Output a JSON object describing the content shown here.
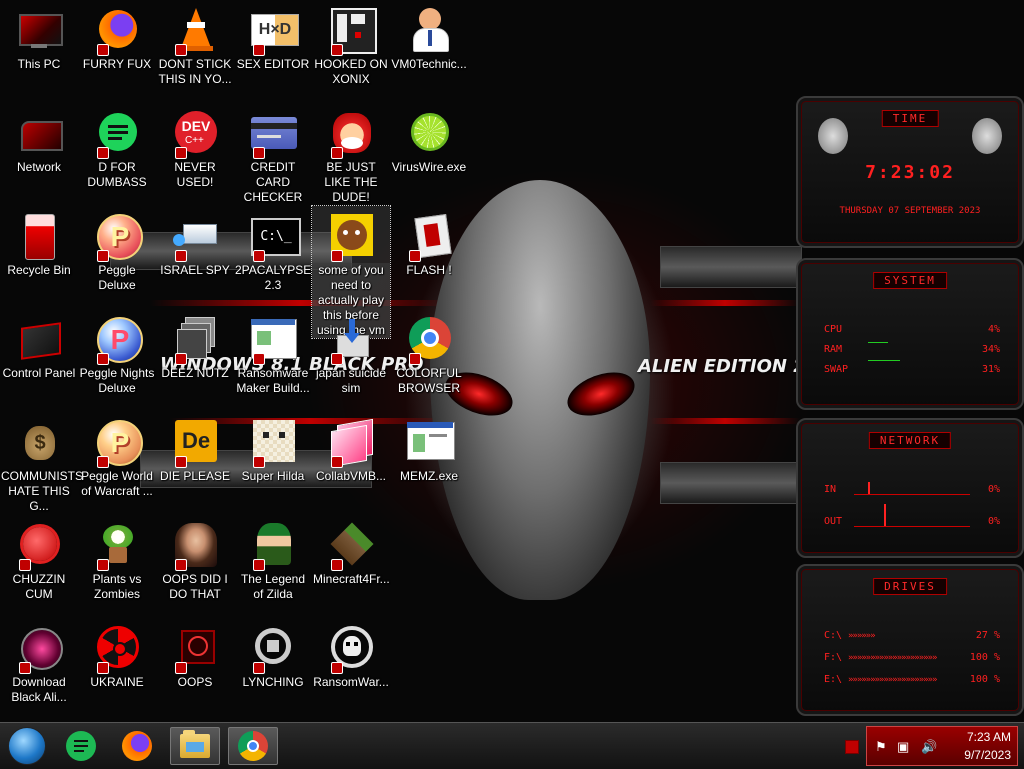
{
  "wallpaper": {
    "title_left": "WINDOWS 8.1 BLACK PRO",
    "title_right": "ALIEN EDITION 20"
  },
  "icons": [
    {
      "label": "This PC",
      "icon": "computer-icon",
      "shortcut": false
    },
    {
      "label": "Network",
      "icon": "network-icon",
      "shortcut": false
    },
    {
      "label": "Recycle Bin",
      "icon": "recycle-bin-icon",
      "shortcut": false
    },
    {
      "label": "Control Panel",
      "icon": "control-panel-icon",
      "shortcut": false
    },
    {
      "label": "COMMUNISTS HATE THIS G...",
      "icon": "money-bag-icon",
      "shortcut": false
    },
    {
      "label": "CHUZZIN CUM",
      "icon": "chuzzle-icon",
      "shortcut": true
    },
    {
      "label": "Download Black Ali...",
      "icon": "alien-globe-icon",
      "shortcut": true
    },
    {
      "label": "FURRY FUX",
      "icon": "firefox-icon",
      "shortcut": true
    },
    {
      "label": "D FOR DUMBASS",
      "icon": "green-chat-icon",
      "shortcut": true
    },
    {
      "label": "Peggle Deluxe",
      "icon": "peggle-icon",
      "shortcut": true
    },
    {
      "label": "Peggle Nights Deluxe",
      "icon": "peggle-nights-icon",
      "shortcut": true
    },
    {
      "label": "Peggle World of Warcraft ...",
      "icon": "peggle-wow-icon",
      "shortcut": true
    },
    {
      "label": "Plants vs Zombies",
      "icon": "plant-icon",
      "shortcut": true
    },
    {
      "label": "UKRAINE",
      "icon": "radiation-icon",
      "shortcut": true
    },
    {
      "label": "DONT STICK THIS IN YO...",
      "icon": "traffic-cone-icon",
      "shortcut": true
    },
    {
      "label": "NEVER USED!",
      "icon": "devcpp-icon",
      "shortcut": true
    },
    {
      "label": "ISRAEL SPY",
      "icon": "network-device-icon",
      "shortcut": true
    },
    {
      "label": "DEEZ NUTZ",
      "icon": "windows-stack-icon",
      "shortcut": true
    },
    {
      "label": "DIE PLEASE",
      "icon": "de-icon",
      "shortcut": true
    },
    {
      "label": "OOPS DID I DO THAT",
      "icon": "portrait-icon",
      "shortcut": true
    },
    {
      "label": "OOPS",
      "icon": "red-screen-icon",
      "shortcut": true
    },
    {
      "label": "SEX EDITOR",
      "icon": "hex-editor-icon",
      "shortcut": true
    },
    {
      "label": "CREDIT CARD CHECKER",
      "icon": "credit-card-icon",
      "shortcut": true
    },
    {
      "label": "2PACALYPSE 2.3",
      "icon": "terminal-icon",
      "shortcut": true
    },
    {
      "label": "Ransomware Maker Build...",
      "icon": "window-app-icon",
      "shortcut": true
    },
    {
      "label": "Super Hilda",
      "icon": "pixel-dog-icon",
      "shortcut": true
    },
    {
      "label": "The Legend of Zilda",
      "icon": "zelda-icon",
      "shortcut": true
    },
    {
      "label": "LYNCHING",
      "icon": "settings-knot-icon",
      "shortcut": true
    },
    {
      "label": "HOOKED ON XONIX",
      "icon": "xonix-icon",
      "shortcut": true
    },
    {
      "label": "BE JUST LIKE THE DUDE!",
      "icon": "elf-icon",
      "shortcut": true
    },
    {
      "label": "some of you need to actually play this before using the vm",
      "icon": "bear-icon",
      "shortcut": true
    },
    {
      "label": "japan suicide sim",
      "icon": "download-icon",
      "shortcut": true
    },
    {
      "label": "CollabVMB...",
      "icon": "pink-window-icon",
      "shortcut": true
    },
    {
      "label": "Minecraft4Fr...",
      "icon": "grass-block-icon",
      "shortcut": true
    },
    {
      "label": "RansomWar...",
      "icon": "skull-icon",
      "shortcut": true
    },
    {
      "label": "VM0Technic...",
      "icon": "doctor-icon",
      "shortcut": false
    },
    {
      "label": "VirusWire.exe",
      "icon": "lime-icon",
      "shortcut": false
    },
    {
      "label": "FLASH !",
      "icon": "flash-icon",
      "shortcut": true
    },
    {
      "label": "COLORFUL BROWSER",
      "icon": "chrome-icon",
      "shortcut": true
    },
    {
      "label": "MEMZ.exe",
      "icon": "memz-icon",
      "shortcut": false
    }
  ],
  "gadgets": {
    "time": {
      "title": "TIME",
      "clock": "7:23:02",
      "date": "THURSDAY 07 SEPTEMBER 2023"
    },
    "system": {
      "title": "SYSTEM",
      "rows": [
        {
          "label": "CPU",
          "value": "4%"
        },
        {
          "label": "RAM",
          "value": "34%"
        },
        {
          "label": "SWAP",
          "value": "31%"
        }
      ]
    },
    "network": {
      "title": "NETWORK",
      "rows": [
        {
          "label": "IN",
          "value": "0%"
        },
        {
          "label": "OUT",
          "value": "0%"
        }
      ]
    },
    "drives": {
      "title": "DRIVES",
      "rows": [
        {
          "label": "C:\\",
          "value": "27 %"
        },
        {
          "label": "F:\\",
          "value": "100 %"
        },
        {
          "label": "E:\\",
          "value": "100 %"
        }
      ]
    }
  },
  "taskbar": {
    "buttons": [
      {
        "name": "start",
        "icon": "start-orb-icon"
      },
      {
        "name": "chat",
        "icon": "green-chat-icon"
      },
      {
        "name": "firefox",
        "icon": "firefox-icon"
      },
      {
        "name": "file-explorer",
        "icon": "folder-icon"
      },
      {
        "name": "chrome",
        "icon": "chrome-icon"
      }
    ],
    "clock": {
      "time": "7:23 AM",
      "date": "9/7/2023"
    }
  },
  "colors": {
    "accent": "#c00000",
    "tray": "#8a0000"
  }
}
